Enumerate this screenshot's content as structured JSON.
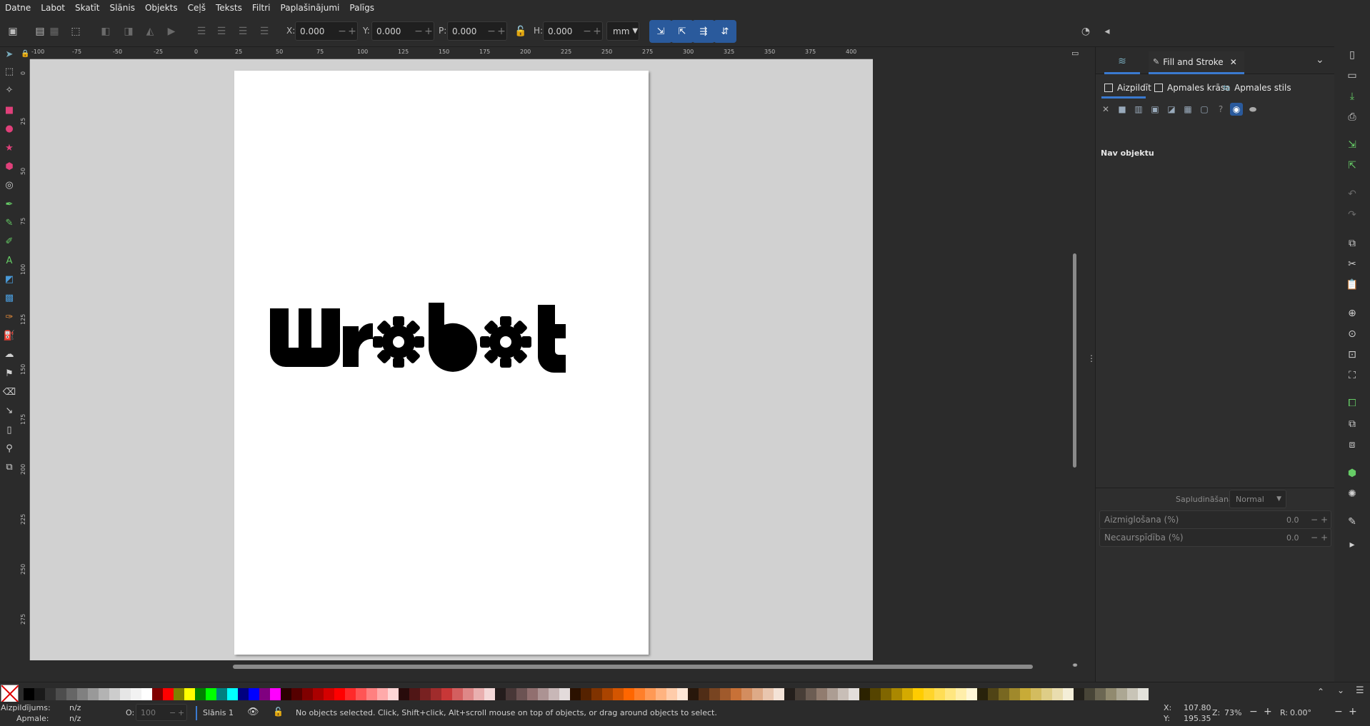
{
  "menu": [
    "Datne",
    "Labot",
    "Skatīt",
    "Slānis",
    "Objekts",
    "Ceļš",
    "Teksts",
    "Filtri",
    "Paplašinājumi",
    "Palīgs"
  ],
  "toolbar": {
    "x_label": "X:",
    "x_value": "0.000",
    "y_label": "Y:",
    "y_value": "0.000",
    "w_label": "P:",
    "w_value": "0.000",
    "h_label": "H:",
    "h_value": "0.000",
    "unit": "mm"
  },
  "ruler": {
    "h_ticks": [
      "-100",
      "-75",
      "-50",
      "-25",
      "0",
      "25",
      "50",
      "75",
      "100",
      "125",
      "150",
      "175",
      "200",
      "225",
      "250",
      "275",
      "300",
      "325",
      "350",
      "375",
      "400"
    ],
    "v_ticks": [
      "0",
      "25",
      "50",
      "75",
      "100",
      "125",
      "150",
      "175",
      "200",
      "225",
      "250",
      "275"
    ]
  },
  "canvas": {
    "logo_text": "Wrobot"
  },
  "dock": {
    "tab_title": "Fill and Stroke",
    "subtab_fill": "Aizpildīt",
    "subtab_stroke_paint": "Apmales krāsa",
    "subtab_stroke_style": "Apmales stils",
    "no_objects": "Nav objektu",
    "blend_label": "Sapludināšanas veids:",
    "blend_value": "Normal",
    "blur_label": "Aizmiglošana (%)",
    "blur_value": "0.0",
    "opacity_label": "Necaurspīdība (%)",
    "opacity_value": "0.0"
  },
  "status": {
    "fill_label": "Aizpildījums:",
    "fill_value": "n/z",
    "stroke_label": "Apmale:",
    "stroke_value": "n/z",
    "opacity_label": "O:",
    "opacity_value": "100",
    "layer": "Slānis 1",
    "message": "No objects selected. Click, Shift+click, Alt+scroll mouse on top of objects, or drag around objects to select.",
    "x_label": "X:",
    "x_value": "107.80",
    "y_label": "Y:",
    "y_value": "195.35",
    "zoom_label": "Z:",
    "zoom_value": "73%",
    "rot_label": "R:",
    "rot_value": "0.00°"
  },
  "palette_colors": [
    "#000000",
    "#1a1a1a",
    "#333333",
    "#4d4d4d",
    "#666666",
    "#808080",
    "#999999",
    "#b3b3b3",
    "#cccccc",
    "#e6e6e6",
    "#f2f2f2",
    "#ffffff",
    "#800000",
    "#ff0000",
    "#808000",
    "#ffff00",
    "#008000",
    "#00ff00",
    "#008080",
    "#00ffff",
    "#000080",
    "#0000ff",
    "#800080",
    "#ff00ff",
    "#2b0000",
    "#550000",
    "#800000",
    "#aa0000",
    "#d40000",
    "#ff0000",
    "#ff2a2a",
    "#ff5555",
    "#ff8080",
    "#ffaaaa",
    "#ffd5d5",
    "#280b0b",
    "#501616",
    "#782121",
    "#a02c2c",
    "#c83737",
    "#d35f5f",
    "#de8787",
    "#e9afaf",
    "#f4d7d7",
    "#241c1c",
    "#483737",
    "#6c5353",
    "#916f6f",
    "#ac9393",
    "#c8b7b7",
    "#e3dbdb",
    "#2b1100",
    "#552200",
    "#803300",
    "#aa4400",
    "#d45500",
    "#ff6600",
    "#ff7f2a",
    "#ff9955",
    "#ffb380",
    "#ffccaa",
    "#ffe6d5",
    "#28170b",
    "#502d16",
    "#784421",
    "#a05a2c",
    "#c87137",
    "#d38d5f",
    "#deaa87",
    "#e9c6af",
    "#f4e3d7",
    "#241f1c",
    "#483e37",
    "#6c5d53",
    "#917c6f",
    "#ac9d93",
    "#c8beb7",
    "#e3dedb",
    "#2b2200",
    "#554400",
    "#806600",
    "#aa8800",
    "#d4aa00",
    "#ffcc00",
    "#ffd42a",
    "#ffdd55",
    "#ffe680",
    "#ffeeaa",
    "#fff6d5",
    "#28220b",
    "#504416",
    "#786721",
    "#a0892c",
    "#c8ab37",
    "#d3bc5f",
    "#decd87",
    "#e9ddaf",
    "#f4eed7",
    "#24221c",
    "#484537",
    "#6c6753",
    "#918a6f",
    "#aca793",
    "#c8c4b7",
    "#e3e2db"
  ]
}
